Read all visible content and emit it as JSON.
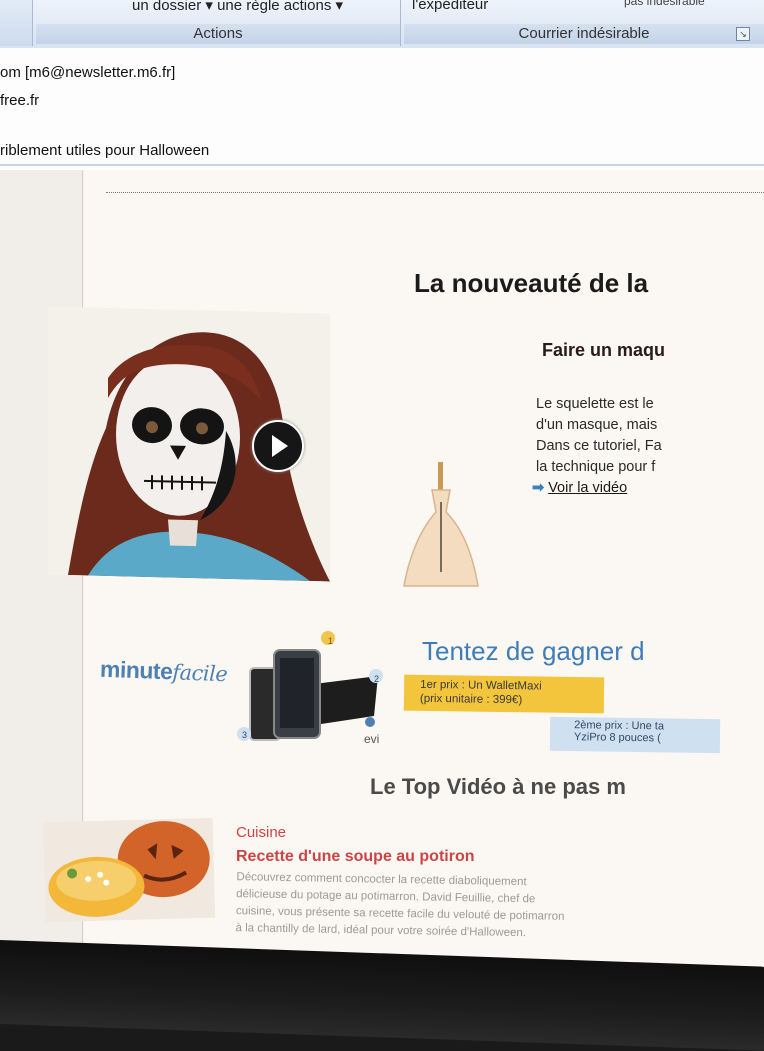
{
  "ribbon": {
    "group1_top": "un dossier ▾  une règle  actions ▾",
    "group1_caption": "Actions",
    "group2_top": "l'expéditeur",
    "group2_caption": "Courrier indésirable",
    "group2_top_right": "pas indésirable"
  },
  "email_header": {
    "from": "om [m6@newsletter.m6.fr]",
    "to": "free.fr",
    "subject": "ribleme­nt utiles pour Halloween"
  },
  "newsletter": {
    "headline": "La nouveauté de la",
    "article": {
      "title": "Faire un maqu",
      "lines": [
        "Le squelette est le",
        "d'un masque, mais",
        "Dans ce tutoriel, Fa",
        "la technique pour f"
      ],
      "watch_link": "Voir la vidéo"
    },
    "promo": {
      "logo_main": "minute",
      "logo_script": "facile",
      "headline": "Tentez de gagner d",
      "prize1_line1": "1er prix : Un WalletMaxi",
      "prize1_line2": "(prix unitaire : 399€)",
      "prize2_line1": "2ème prix : Une ta",
      "prize2_line2": "YziPro 8 pouces (",
      "device_brand": "evi",
      "badge1": "1",
      "badge2": "2",
      "badge3": "3"
    },
    "top_video": {
      "heading": "Le Top Vidéo à ne pas m",
      "category": "Cuisine",
      "title": "Recette d'une soupe au potiron",
      "desc_lines": [
        "Découvrez comment concocter la recette diaboliquement",
        "délicieuse du potage au potimarron. David Feuillie, chef de",
        "cuisine, vous présente sa recette facile du velouté de potimarron",
        "à la chantilly de lard, idéal pour votre soirée d'Halloween."
      ]
    }
  },
  "colors": {
    "link_blue": "#3f7db8",
    "prize_yellow": "#f3c53c",
    "recipe_red": "#c44"
  }
}
